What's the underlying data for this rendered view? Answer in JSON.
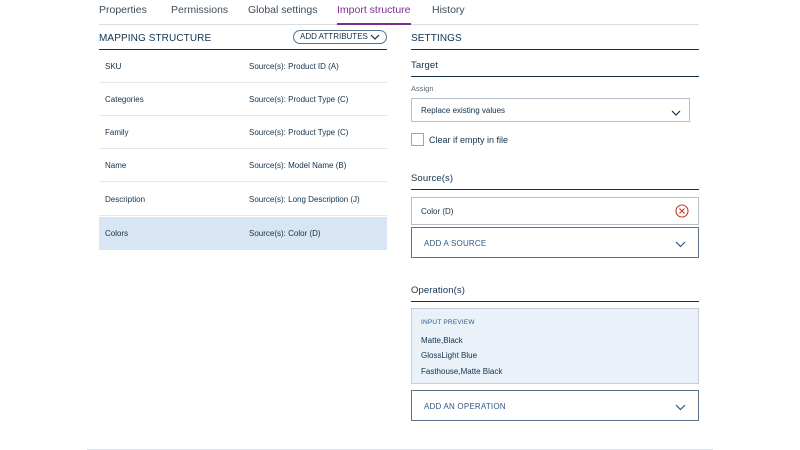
{
  "tabs": [
    {
      "label": "Properties"
    },
    {
      "label": "Permissions"
    },
    {
      "label": "Global settings"
    },
    {
      "label": "Import structure",
      "active": true
    },
    {
      "label": "History"
    }
  ],
  "mapping": {
    "title": "MAPPING STRUCTURE",
    "add_attributes_label": "ADD ATTRIBUTES",
    "rows": [
      {
        "name": "SKU",
        "source": "Source(s): Product ID (A)"
      },
      {
        "name": "Categories",
        "source": "Source(s): Product Type (C)"
      },
      {
        "name": "Family",
        "source": "Source(s): Product Type (C)"
      },
      {
        "name": "Name",
        "source": "Source(s): Model Name (B)"
      },
      {
        "name": "Description",
        "source": "Source(s): Long Description (J)"
      },
      {
        "name": "Colors",
        "source": "Source(s): Color (D)",
        "selected": true
      }
    ]
  },
  "settings": {
    "title": "SETTINGS",
    "target": {
      "heading": "Target",
      "assign_label": "Assign",
      "assign_value": "Replace existing values",
      "clear_label": "Clear if empty in file"
    },
    "sources": {
      "heading": "Source(s)",
      "items": [
        {
          "value": "Color (D)"
        }
      ],
      "add_label": "ADD A SOURCE"
    },
    "operations": {
      "heading": "Operation(s)",
      "preview_title": "INPUT PREVIEW",
      "preview_lines": [
        "Matte,Black",
        "GlossLight Blue",
        "Fasthouse,Matte Black"
      ],
      "add_label": "ADD AN OPERATION"
    }
  },
  "colors": {
    "accent": "#7c2e8f",
    "selected_row": "#d8e5f2",
    "remove_icon": "#c0392b",
    "preview_bg": "#eaf1f8"
  }
}
